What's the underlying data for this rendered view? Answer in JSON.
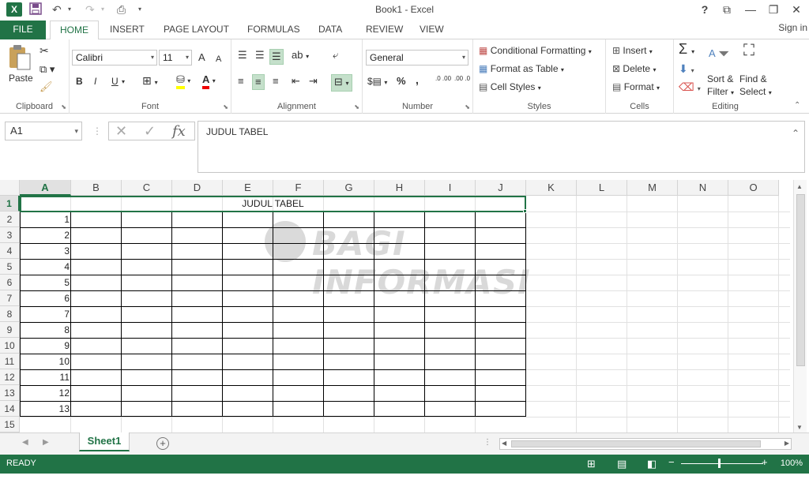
{
  "window": {
    "title": "Book1 - Excel",
    "logo": "X",
    "help": "?",
    "ribbon_display": "⧉",
    "minimize": "—",
    "restore": "❐",
    "close": "✕",
    "sign_in": "Sign in"
  },
  "quick_access": {
    "save": "💾",
    "undo": "↶",
    "redo": "↷",
    "print_preview": "⎙",
    "customize": "▾"
  },
  "tabs": [
    "FILE",
    "HOME",
    "INSERT",
    "PAGE LAYOUT",
    "FORMULAS",
    "DATA",
    "REVIEW",
    "VIEW"
  ],
  "ribbon": {
    "clipboard": {
      "label": "Clipboard",
      "paste": "Paste"
    },
    "font": {
      "label": "Font",
      "name": "Calibri",
      "size": "11",
      "bold": "B",
      "italic": "I",
      "underline": "U",
      "grow": "A",
      "shrink": "A"
    },
    "alignment": {
      "label": "Alignment"
    },
    "number": {
      "label": "Number",
      "format": "General",
      "percent": "%",
      "comma": ",",
      "inc_decimal": ".0 .00",
      "dec_decimal": ".00 .0"
    },
    "styles": {
      "label": "Styles",
      "conditional": "Conditional Formatting",
      "format_table": "Format as Table",
      "cell_styles": "Cell Styles"
    },
    "cells": {
      "label": "Cells",
      "insert": "Insert",
      "delete": "Delete",
      "format": "Format"
    },
    "editing": {
      "label": "Editing",
      "sort_filter_1": "Sort &",
      "sort_filter_2": "Filter",
      "find_select_1": "Find &",
      "find_select_2": "Select"
    }
  },
  "formula_bar": {
    "name_box": "A1",
    "fx": "fx",
    "content": "JUDUL TABEL"
  },
  "grid": {
    "columns": [
      "A",
      "B",
      "C",
      "D",
      "E",
      "F",
      "G",
      "H",
      "I",
      "J",
      "K",
      "L",
      "M",
      "N",
      "O"
    ],
    "rows": [
      "1",
      "2",
      "3",
      "4",
      "5",
      "6",
      "7",
      "8",
      "9",
      "10",
      "11",
      "12",
      "13",
      "14",
      "15"
    ],
    "merged_title": "JUDUL TABEL",
    "column_a_values": [
      "1",
      "2",
      "3",
      "4",
      "5",
      "6",
      "7",
      "8",
      "9",
      "10",
      "11",
      "12",
      "13"
    ],
    "active_cell": "A1"
  },
  "watermark": {
    "text": "BAGI INFORMASI"
  },
  "sheets": {
    "active": "Sheet1",
    "add": "+"
  },
  "status": {
    "ready": "READY",
    "zoom_out": "−",
    "zoom_in": "+",
    "zoom": "100%"
  },
  "colors": {
    "accent": "#217346"
  }
}
